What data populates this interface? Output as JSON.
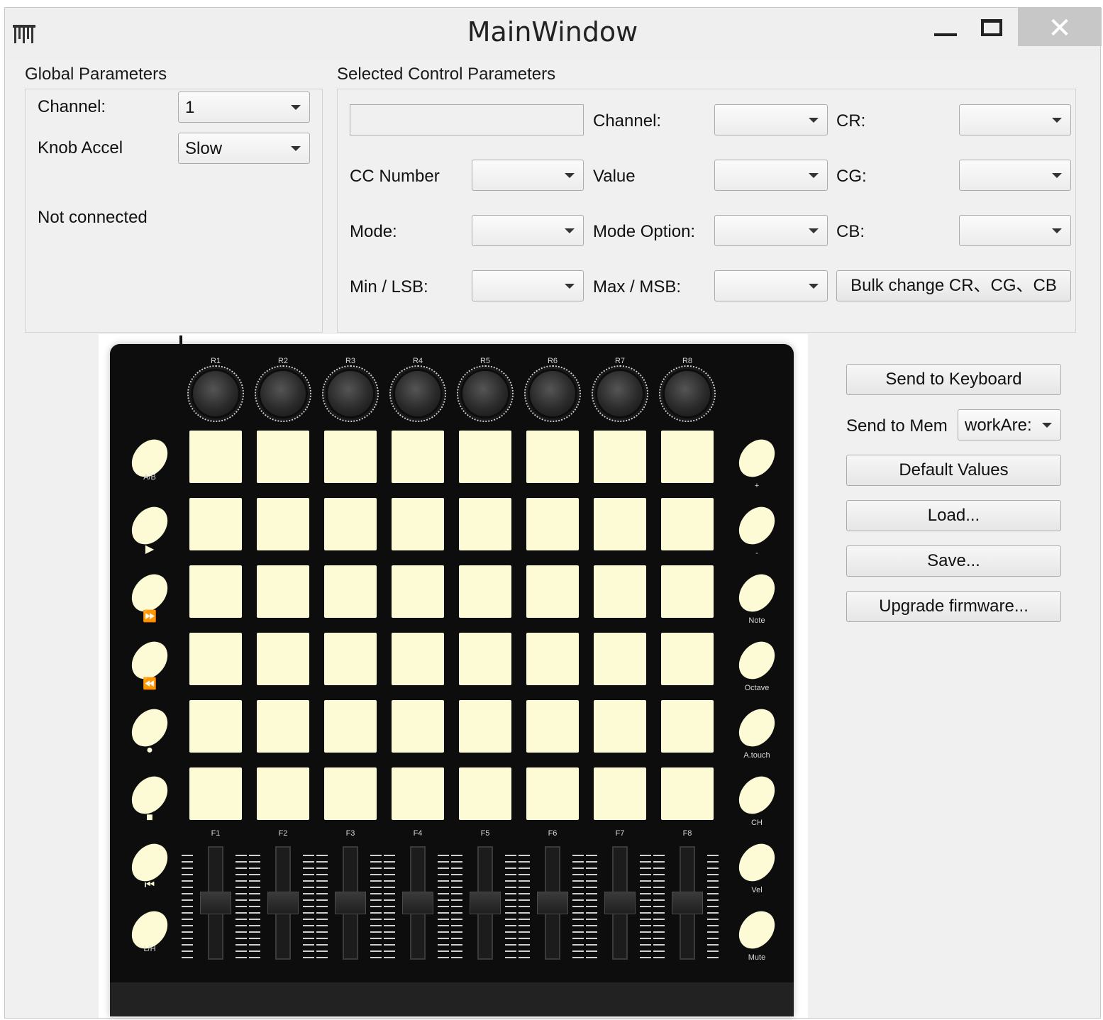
{
  "window": {
    "title": "MainWindow",
    "min_glyph": "",
    "close_glyph": "✕"
  },
  "global": {
    "group_title": "Global Parameters",
    "channel_label": "Channel:",
    "channel_value": "1",
    "knob_accel_label": "Knob Accel",
    "knob_accel_value": "Slow",
    "status": "Not connected"
  },
  "selected": {
    "group_title": "Selected Control Parameters",
    "name_value": "",
    "channel_label": "Channel:",
    "channel_value": "",
    "cr_label": "CR:",
    "cr_value": "",
    "cc_number_label": "CC Number",
    "cc_number_value": "",
    "value_label": "Value",
    "value_value": "",
    "cg_label": "CG:",
    "cg_value": "",
    "mode_label": "Mode:",
    "mode_value": "",
    "mode_option_label": "Mode Option:",
    "mode_option_value": "",
    "cb_label": "CB:",
    "cb_value": "",
    "min_lsb_label": "Min / LSB:",
    "min_lsb_value": "",
    "max_msb_label": "Max / MSB:",
    "max_msb_value": "",
    "bulk_button": "Bulk change CR、CG、CB"
  },
  "actions": {
    "send_keyboard": "Send to Keyboard",
    "send_mem_label": "Send to Mem",
    "send_mem_value": "workAre:",
    "default_values": "Default Values",
    "load": "Load...",
    "save": "Save...",
    "upgrade": "Upgrade firmware..."
  },
  "device": {
    "knob_labels": [
      "R1",
      "R2",
      "R3",
      "R4",
      "R5",
      "R6",
      "R7",
      "R8"
    ],
    "fader_labels": [
      "F1",
      "F2",
      "F3",
      "F4",
      "F5",
      "F6",
      "F7",
      "F8"
    ],
    "fader_levels": [
      0.5,
      0.5,
      0.5,
      0.5,
      0.5,
      0.5,
      0.5,
      0.5
    ],
    "left_buttons": [
      {
        "label": "A/B",
        "glyph": ""
      },
      {
        "label": "",
        "glyph": "▶"
      },
      {
        "label": "",
        "glyph": "⏩"
      },
      {
        "label": "",
        "glyph": "⏪"
      },
      {
        "label": "",
        "glyph": "●"
      },
      {
        "label": "",
        "glyph": "■"
      },
      {
        "label": "",
        "glyph": "⏮"
      },
      {
        "label": "L/H",
        "glyph": ""
      }
    ],
    "right_buttons": [
      "+",
      "-",
      "Note",
      "Octave",
      "A.touch",
      "CH",
      "Vel",
      "Mute"
    ],
    "pad_rows": 6,
    "pad_cols": 8,
    "pad_color": "#fdfbd6"
  }
}
